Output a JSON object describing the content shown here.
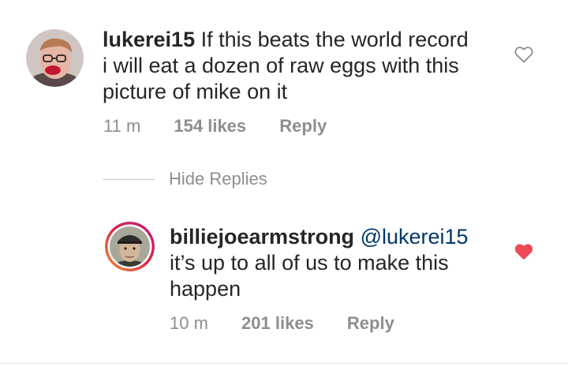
{
  "comments": [
    {
      "username": "lukerei15",
      "text": "If this beats the world record i will eat a dozen of raw eggs with this picture of mike on it",
      "line1": "If this beats the world record",
      "line2": "i will eat a dozen of raw eggs with this",
      "line3": "picture of mike on it",
      "time": "11 m",
      "likes": "154 likes",
      "reply_label": "Reply",
      "liked": false,
      "heart_icon": "heart-outline-icon"
    }
  ],
  "hide_replies_label": "Hide Replies",
  "reply": {
    "username": "billiejoearmstrong",
    "mention": "@lukerei15",
    "line2": "it’s up to all of us to make this",
    "line3": "happen",
    "time": "10 m",
    "likes": "201 likes",
    "reply_label": "Reply",
    "liked": true,
    "heart_icon": "heart-filled-icon",
    "heart_color": "#ed4956"
  },
  "colors": {
    "text": "#262626",
    "secondary": "#8e8e8e",
    "like_red": "#ed4956",
    "story_ring_start": "#f09433",
    "story_ring_end": "#bc1888"
  }
}
